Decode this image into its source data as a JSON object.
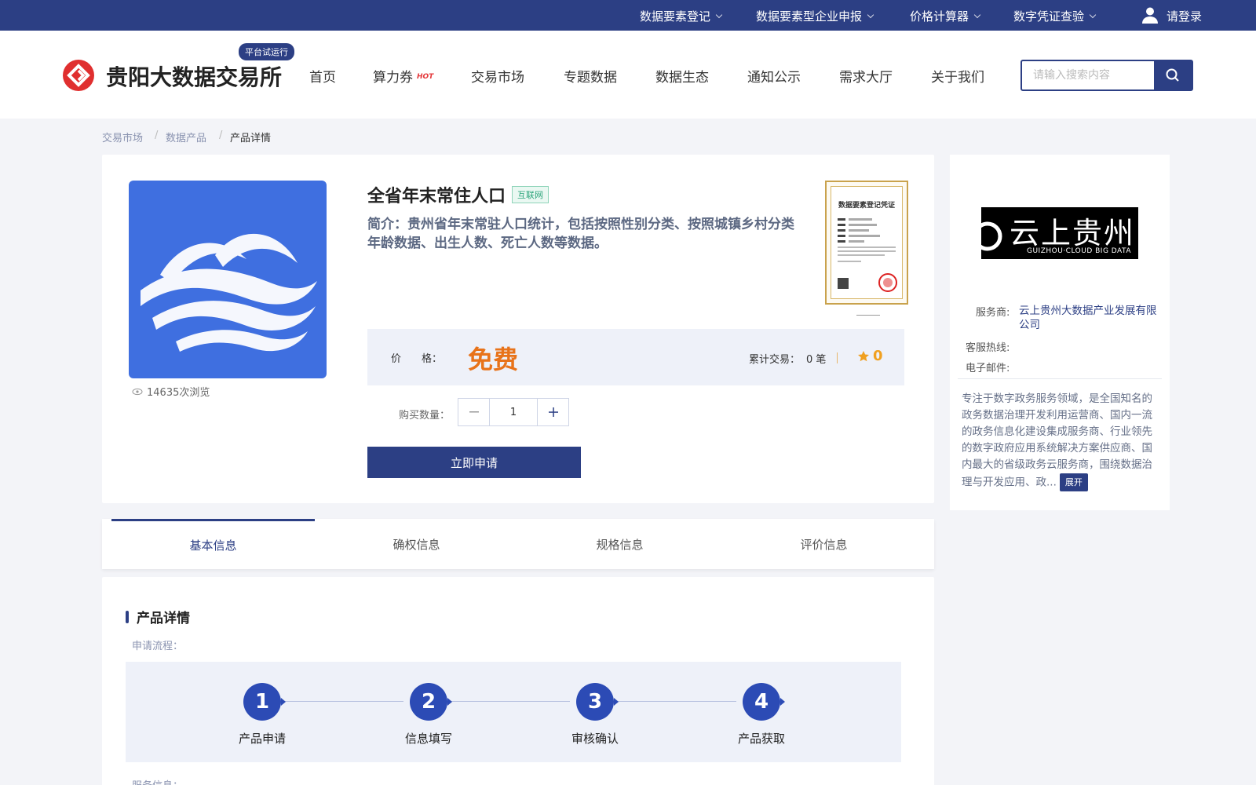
{
  "topbar": {
    "items": [
      {
        "label": "数据要素登记"
      },
      {
        "label": "数据要素型企业申报"
      },
      {
        "label": "价格计算器"
      },
      {
        "label": "数字凭证查验"
      }
    ],
    "login_label": "请登录"
  },
  "header": {
    "brand": "贵阳大数据交易所",
    "trial_badge": "平台试运行",
    "nav": [
      {
        "label": "首页"
      },
      {
        "label": "算力券"
      },
      {
        "label": "交易市场"
      },
      {
        "label": "专题数据"
      },
      {
        "label": "数据生态"
      },
      {
        "label": "通知公示"
      },
      {
        "label": "需求大厅"
      },
      {
        "label": "关于我们"
      }
    ],
    "hot_badge": "HOT",
    "search_placeholder": "请输入搜索内容"
  },
  "breadcrumb": {
    "items": [
      "交易市场",
      "数据产品",
      "产品详情"
    ],
    "separator": "/"
  },
  "product": {
    "views": "14635次浏览",
    "title": "全省年末常住人口",
    "tag": "互联网",
    "description": "简介：贵州省年末常驻人口统计，包括按照性别分类、按照城镇乡村分类年龄数据、出生人数、死亡人数等数据。",
    "certificate": {
      "title": "数据要素登记凭证"
    },
    "price_label": "价　　格：",
    "price_value": "免费",
    "trades_label": "累计交易：",
    "trades_value": "0 笔",
    "rating": "0",
    "quantity_label": "购买数量：",
    "quantity": "1",
    "apply_label": "立即申请"
  },
  "tabs": [
    {
      "label": "基本信息",
      "active": true
    },
    {
      "label": "确权信息"
    },
    {
      "label": "规格信息"
    },
    {
      "label": "评价信息"
    }
  ],
  "details": {
    "section_title": "产品详情",
    "process_label": "申请流程：",
    "steps": [
      {
        "num": "1",
        "label": "产品申请"
      },
      {
        "num": "2",
        "label": "信息填写"
      },
      {
        "num": "3",
        "label": "审核确认"
      },
      {
        "num": "4",
        "label": "产品获取"
      }
    ],
    "service_label": "服务信息："
  },
  "provider": {
    "logo_text": "云上贵州",
    "logo_subtext": "GUIZHOU·CLOUD BIG DATA",
    "service_label": "服务商:",
    "service_value": "云上贵州大数据产业发展有限公司",
    "hotline_label": "客服热线:",
    "email_label": "电子邮件:",
    "description": "专注于数字政务服务领域，是全国知名的政务数据治理开发利用运营商、国内一流的政务信息化建设集成服务商、行业领先的数字政府应用系统解决方案供应商、国内最大的省级政务云服务商，围绕数据治理与开发应用、政...",
    "expand_label": "展开"
  },
  "colors": {
    "primary": "#2c3f84",
    "price": "#e8731a",
    "step": "#2c4bb5",
    "product_image_bg": "#3f6fe0"
  }
}
